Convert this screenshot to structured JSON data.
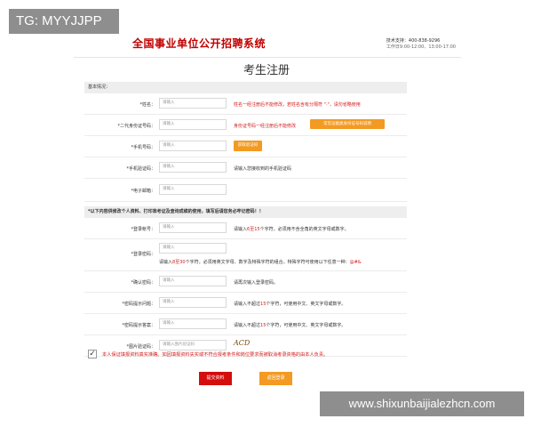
{
  "watermark_top": "TG: MYYJJPP",
  "watermark_bottom": "www.shixunbaijialezhcn.com",
  "header": {
    "site_title": "全国事业单位公开招聘系统",
    "contact_line1": "技术支持：400-838-9296",
    "contact_line2": "工作日9:00-12:00、13:00-17:00"
  },
  "page_title": "考生注册",
  "section_basic": "基本情况：",
  "section_account": "*以下内容供修改个人资料、打印准考证及查询成绩的使用，填写后请您务必牢记密码！！",
  "basic_rows": [
    {
      "label": "*姓名：",
      "placeholder": "请输入",
      "hint": "姓名一经注册后不能修改，若姓名含有分隔符 \"·\"，请勿省略使用"
    },
    {
      "label": "*二代身份证号码：",
      "placeholder": "请输入",
      "hint": "身份证号码一经注册后不能修改",
      "button": "常见证据类身份证号码说明"
    },
    {
      "label": "*手机号码：",
      "placeholder": "请输入",
      "button": "获取验证码"
    },
    {
      "label": "*手机验证码：",
      "placeholder": "请输入",
      "hint": "请输入您接收到的手机验证码"
    },
    {
      "label": "*电子邮箱：",
      "placeholder": "请输入"
    }
  ],
  "account_rows": [
    {
      "label": "*登录帐号：",
      "placeholder": "请输入",
      "hint_pre": "请输入",
      "hint_num": "6至15",
      "hint_post": "个字符，必须用不含全角的英文字母或数字。"
    },
    {
      "label": "*登录密码：",
      "placeholder": "请输入",
      "hint_pre": "请输入",
      "hint_num": "8至30",
      "hint_post": "个字符，必须用英文字母、数字及特殊字符的组合，特殊字符可使用以下任意一种：",
      "hint_special": "@#&"
    },
    {
      "label": "*确认密码：",
      "placeholder": "请输入",
      "hint": "请再次输入登录密码。"
    },
    {
      "label": "*密码提示问题：",
      "placeholder": "请输入",
      "hint_pre": "请输入不超过",
      "hint_num": "15",
      "hint_post": "个字符，可使用中文、英文字母或数字。"
    },
    {
      "label": "*密码提示答案：",
      "placeholder": "请输入",
      "hint_pre": "请输入不超过",
      "hint_num": "15",
      "hint_post": "个字符，可使用中文、英文字母或数字。"
    },
    {
      "label": "*图片验证码：",
      "placeholder": "请输入图片验证码",
      "captcha": "ACD"
    }
  ],
  "agree_text": "本人保证填报资料真实准确。如因填报资料失实或不符合报考条件和岗位要求而被取消考录资格的由本人负责。",
  "submit_label": "提交资料",
  "back_label": "返回登录",
  "colors": {
    "accent_red": "#d40d0d",
    "accent_orange": "#f39a22"
  }
}
